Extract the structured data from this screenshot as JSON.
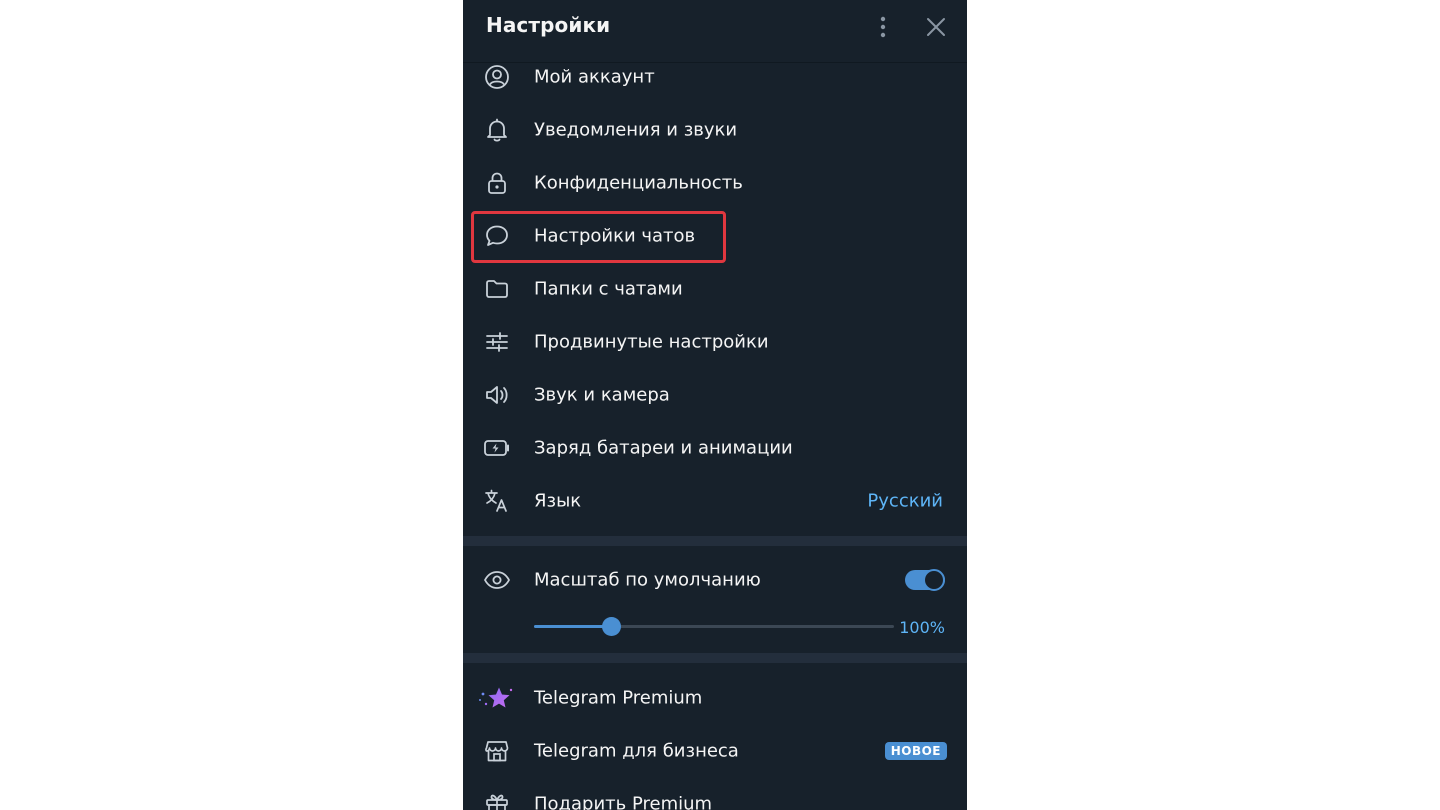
{
  "header": {
    "title": "Настройки"
  },
  "menu": {
    "items": [
      {
        "label": "Мой аккаунт",
        "icon": "account-circle-icon"
      },
      {
        "label": "Уведомления и звуки",
        "icon": "bell-icon"
      },
      {
        "label": "Конфиденциальность",
        "icon": "lock-icon"
      },
      {
        "label": "Настройки чатов",
        "icon": "chat-bubble-icon"
      },
      {
        "label": "Папки с чатами",
        "icon": "folder-icon"
      },
      {
        "label": "Продвинутые настройки",
        "icon": "sliders-icon"
      },
      {
        "label": "Звук и камера",
        "icon": "speaker-icon"
      },
      {
        "label": "Заряд батареи и анимации",
        "icon": "battery-bolt-icon"
      },
      {
        "label": "Язык",
        "icon": "translate-icon",
        "value": "Русский"
      }
    ]
  },
  "scale": {
    "label": "Масштаб по умолчанию",
    "enabled": true,
    "value_label": "100%",
    "slider_fraction": 0.215
  },
  "extras": {
    "items": [
      {
        "label": "Telegram Premium",
        "icon": "premium-star-icon"
      },
      {
        "label": "Telegram для бизнеса",
        "icon": "shop-icon",
        "badge": "НОВОЕ"
      },
      {
        "label": "Подарить Premium",
        "icon": "gift-icon"
      }
    ]
  },
  "colors": {
    "panel_bg": "#17212b",
    "accent": "#4a8fd2",
    "link": "#5eb5f7",
    "highlight": "#e0373f"
  }
}
